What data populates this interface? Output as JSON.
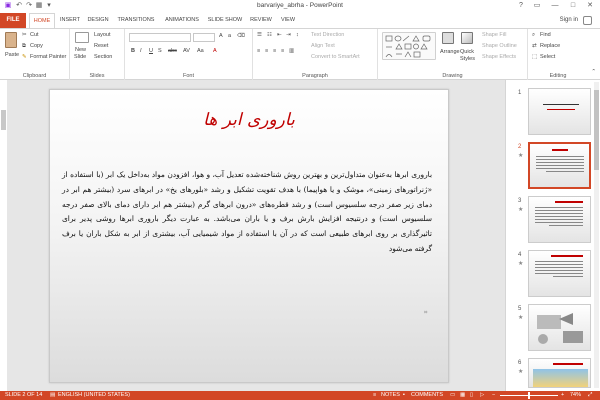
{
  "window": {
    "title": "barvariye_abrha - PowerPoint",
    "help": "?",
    "restore": "▭",
    "minimize": "—",
    "maximize": "□",
    "close": "✕"
  },
  "tabs": {
    "file": "FILE",
    "items": [
      "HOME",
      "INSERT",
      "DESIGN",
      "TRANSITIONS",
      "ANIMATIONS",
      "SLIDE SHOW",
      "REVIEW",
      "VIEW"
    ],
    "active": "HOME",
    "signin": "Sign in"
  },
  "ribbon": {
    "clipboard": {
      "paste": "Paste",
      "cut": "Cut",
      "copy": "Copy",
      "format_painter": "Format Painter",
      "label": "Clipboard"
    },
    "slides": {
      "new_slide": "New",
      "new_slide_2": "Slide",
      "layout": "Layout",
      "reset": "Reset",
      "section": "Section",
      "label": "Slides"
    },
    "font": {
      "label": "Font"
    },
    "paragraph": {
      "text_direction": "Text Direction",
      "align_text": "Align Text",
      "convert_smartart": "Convert to SmartArt",
      "label": "Paragraph"
    },
    "drawing": {
      "arrange": "Arrange",
      "quick_styles": "Quick",
      "quick_styles_2": "Styles",
      "shape_fill": "Shape Fill",
      "shape_outline": "Shape Outline",
      "shape_effects": "Shape Effects",
      "label": "Drawing"
    },
    "editing": {
      "find": "Find",
      "replace": "Replace",
      "select": "Select",
      "label": "Editing"
    }
  },
  "slide": {
    "title": "باروری ابر ها",
    "body": "باروری ابرها به‌عنوان متداول‌ترین و بهترین روش شناخته‌شده تعدیل آب، و هوا، افزودن مواد به‌داخل یک ابر (با استفاده از «ژنراتورهای زمینی»، موشک و یا هواپیما) با هدف تقویت تشکیل و رشد «بلورهای یخ» در ابرهای سرد (بیشتر هم ابر در دمای زیر صفر درجه سلسیوس است) و رشد قطره‌های «درون ابرهای گرم (بیشتر هم ابر دارای دمای بالای صفر درجه سلسیوس است) و درنتیجه افزایش بارش برف و یا باران می‌باشد. به عبارت دیگر باروری ابرها روشی پدیر برای تاثیرگذاری بر روی ابرهای طبیعی است که در آن با استفاده از مواد شیمیایی آب، بیشتری از ابر به شکل باران یا برف گرفته می‌شود",
    "cursor_mark": "⌗"
  },
  "thumbnails": [
    {
      "num": "1",
      "star": ""
    },
    {
      "num": "2",
      "star": "★"
    },
    {
      "num": "3",
      "star": "★"
    },
    {
      "num": "4",
      "star": "★"
    },
    {
      "num": "5",
      "star": "★"
    },
    {
      "num": "6",
      "star": "★"
    }
  ],
  "status": {
    "slide_info": "SLIDE 2 OF 14",
    "language": "ENGLISH (UNITED STATES)",
    "notes": "NOTES",
    "comments": "COMMENTS",
    "zoom": "74%"
  },
  "colors": {
    "accent": "#d24726",
    "title_red": "#c00000"
  }
}
